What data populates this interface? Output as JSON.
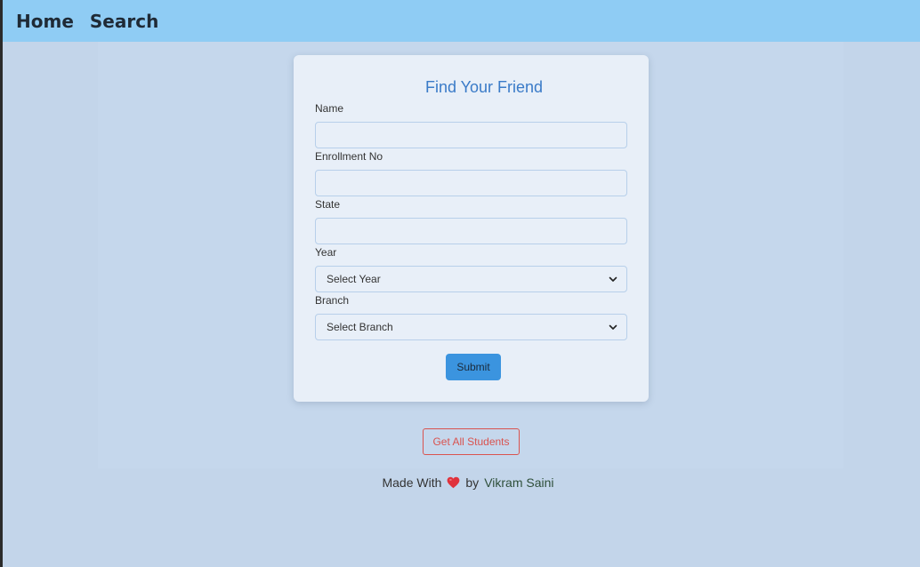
{
  "nav": {
    "home": "Home",
    "search": "Search"
  },
  "form": {
    "title": "Find Your Friend",
    "name_label": "Name",
    "enrollment_label": "Enrollment No",
    "state_label": "State",
    "year_label": "Year",
    "year_value": "Select Year",
    "branch_label": "Branch",
    "branch_value": "Select Branch",
    "submit_label": "Submit"
  },
  "actions": {
    "get_all_label": "Get All Students"
  },
  "footer": {
    "made_with": "Made With",
    "by": "by",
    "author": "Vikram Saini"
  },
  "icons": {
    "heart": "heart-icon",
    "chevron": "chevron-down-icon"
  },
  "colors": {
    "navbar": "#8fccf4",
    "title": "#3a7bc8",
    "submit": "#3b94df",
    "danger": "#d9534f",
    "heart": "#e0323c"
  }
}
